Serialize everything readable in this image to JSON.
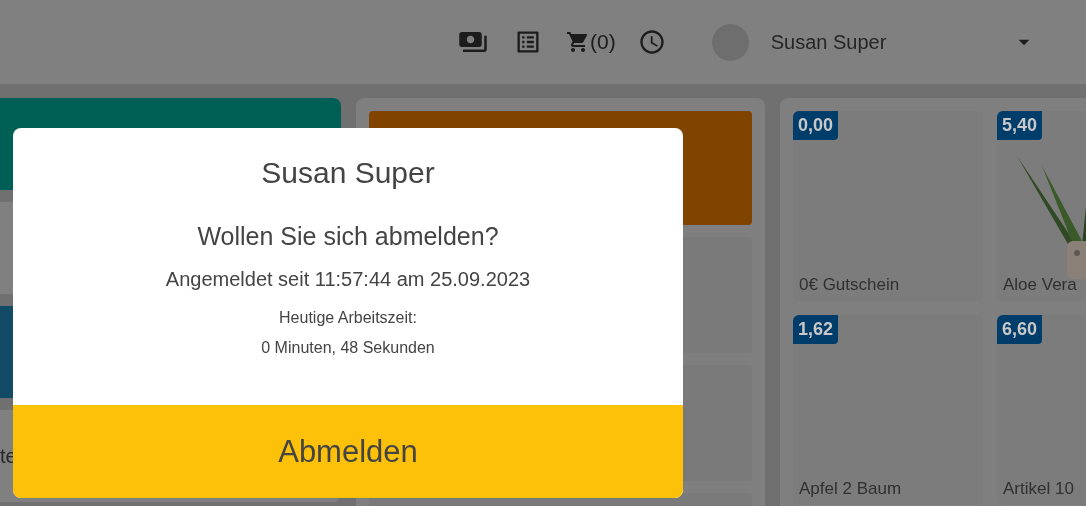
{
  "header": {
    "cart_count": "(0)",
    "user_name": "Susan Super"
  },
  "left_tiles": [
    {
      "color": "#005f55"
    },
    {
      "color": "#808080"
    },
    {
      "color": "#134a66"
    },
    {
      "color": "#808080",
      "label": "te"
    }
  ],
  "middle_tiles": [
    {
      "color": "#804400"
    },
    {
      "color": "#7a7a7a"
    },
    {
      "color": "#7a7a7a"
    },
    {
      "color": "#7a7a7a"
    }
  ],
  "products": [
    {
      "price": "0,00",
      "name": "0€ Gutschein"
    },
    {
      "price": "5,40",
      "name": "Aloe Vera",
      "kind": "picture"
    },
    {
      "price": "1,62",
      "name": "Apfel 2 Baum"
    },
    {
      "price": "6,60",
      "name": "Artikel 10"
    }
  ],
  "dialog": {
    "title": "Susan Super",
    "question": "Wollen Sie sich abmelden?",
    "since": "Angemeldet seit 11:57:44 am 25.09.2023",
    "worktime_label": "Heutige Arbeitszeit:",
    "worktime": "0 Minuten, 48 Sekunden",
    "button": "Abmelden"
  }
}
